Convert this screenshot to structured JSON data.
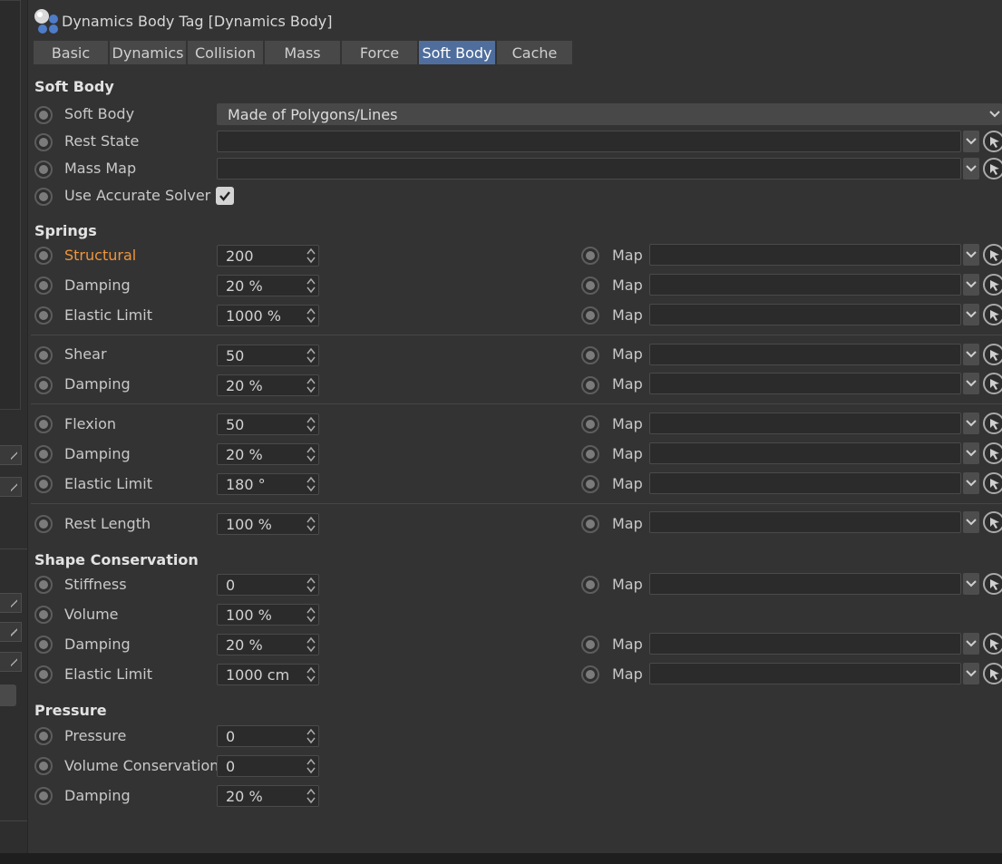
{
  "title": "Dynamics Body Tag [Dynamics Body]",
  "tabs": [
    {
      "label": "Basic"
    },
    {
      "label": "Dynamics"
    },
    {
      "label": "Collision"
    },
    {
      "label": "Mass"
    },
    {
      "label": "Force"
    },
    {
      "label": "Soft Body"
    },
    {
      "label": "Cache"
    }
  ],
  "active_tab": "Soft Body",
  "sections": {
    "soft_body": "Soft Body",
    "springs": "Springs",
    "shape_conservation": "Shape Conservation",
    "pressure": "Pressure"
  },
  "soft_body": {
    "soft_body_label": "Soft Body",
    "soft_body_value": "Made of Polygons/Lines",
    "rest_state_label": "Rest State",
    "mass_map_label": "Mass Map",
    "accurate_solver_label": "Use Accurate Solver",
    "accurate_solver_checked": true
  },
  "springs": {
    "structural_label": "Structural",
    "structural_value": "200",
    "damping1_label": "Damping",
    "damping1_value": "20 %",
    "elastic1_label": "Elastic Limit",
    "elastic1_value": "1000 %",
    "shear_label": "Shear",
    "shear_value": "50",
    "damping2_label": "Damping",
    "damping2_value": "20 %",
    "flexion_label": "Flexion",
    "flexion_value": "50",
    "damping3_label": "Damping",
    "damping3_value": "20 %",
    "elastic3_label": "Elastic Limit",
    "elastic3_value": "180 °",
    "rest_length_label": "Rest Length",
    "rest_length_value": "100 %"
  },
  "shape": {
    "stiffness_label": "Stiffness",
    "stiffness_value": "0",
    "volume_label": "Volume",
    "volume_value": "100 %",
    "damping_label": "Damping",
    "damping_value": "20 %",
    "elastic_label": "Elastic Limit",
    "elastic_value": "1000 cm"
  },
  "pressure": {
    "pressure_label": "Pressure",
    "pressure_value": "0",
    "volcons_label": "Volume Conservation",
    "volcons_value": "0",
    "damping_label": "Damping",
    "damping_value": "20 %"
  },
  "map_label": "Map",
  "colors": {
    "panel_bg": "#333333",
    "active_tab": "#4f6e9d",
    "highlight_label": "#f0953b"
  }
}
